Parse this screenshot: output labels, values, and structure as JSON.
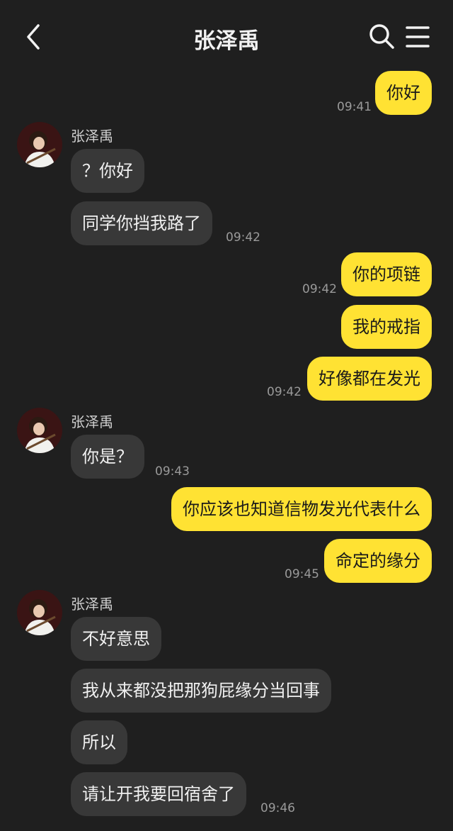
{
  "header": {
    "title": "张泽禹",
    "back_icon": "chevron-left-icon",
    "search_icon": "search-icon",
    "menu_icon": "menu-icon"
  },
  "colors": {
    "background": "#1f1f1f",
    "outgoing_bubble": "#ffe233",
    "incoming_bubble": "#383838"
  },
  "contact": {
    "name": "张泽禹"
  },
  "messages": [
    {
      "dir": "out",
      "text": "你好",
      "time": "09:41"
    },
    {
      "dir": "in",
      "sender": "张泽禹",
      "text": "？你好"
    },
    {
      "dir": "in",
      "text": "同学你挡我路了",
      "time": "09:42"
    },
    {
      "dir": "out",
      "text": "你的项链",
      "time": "09:42"
    },
    {
      "dir": "out",
      "text": "我的戒指"
    },
    {
      "dir": "out",
      "text": "好像都在发光",
      "time": "09:42"
    },
    {
      "dir": "in",
      "sender": "张泽禹",
      "text": "你是？",
      "time": "09:43"
    },
    {
      "dir": "out",
      "text": "你应该也知道信物发光代表什么"
    },
    {
      "dir": "out",
      "text": "命定的缘分",
      "time": "09:45"
    },
    {
      "dir": "in",
      "sender": "张泽禹",
      "text": "不好意思"
    },
    {
      "dir": "in",
      "text": "我从来都没把那狗屁缘分当回事"
    },
    {
      "dir": "in",
      "text": "所以"
    },
    {
      "dir": "in",
      "text": "请让开我要回宿舍了",
      "time": "09:46"
    }
  ]
}
